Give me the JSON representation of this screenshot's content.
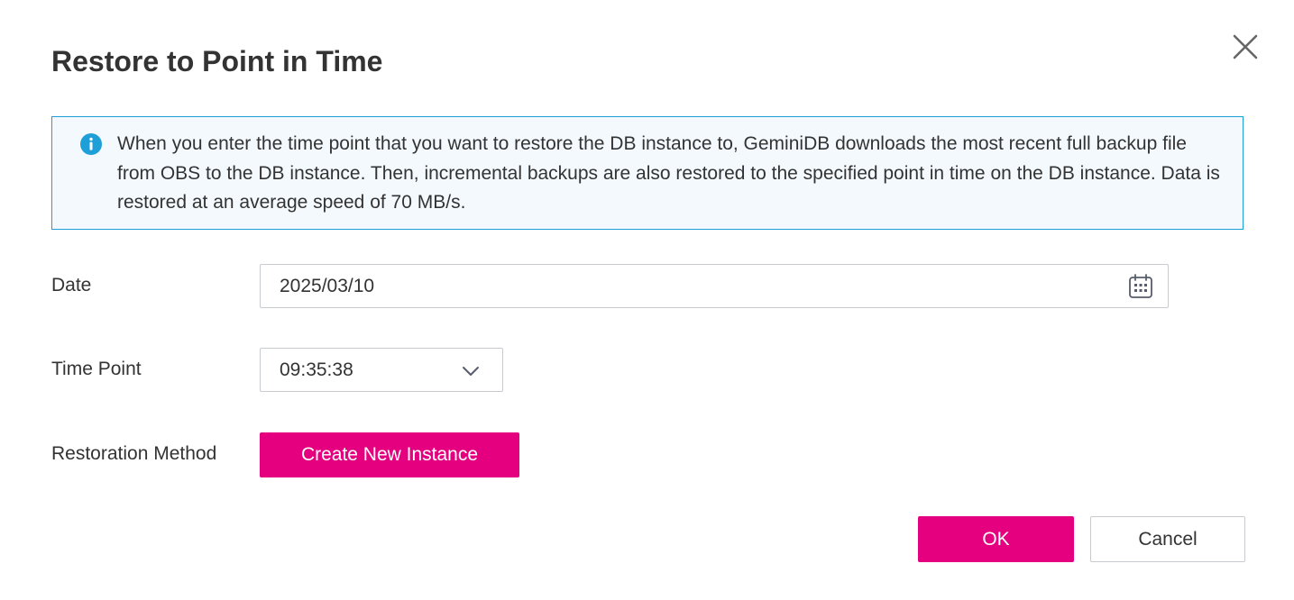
{
  "dialog": {
    "title": "Restore to Point in Time"
  },
  "info": {
    "text": "When you enter the time point that you want to restore the DB instance to, GeminiDB downloads the most recent full backup file from OBS to the DB instance. Then, incremental backups are also restored to the specified point in time on the DB instance. Data is restored at an average speed of 70 MB/s."
  },
  "form": {
    "date_label": "Date",
    "date_value": "2025/03/10",
    "time_label": "Time Point",
    "time_value": "09:35:38",
    "method_label": "Restoration Method",
    "method_button": "Create New Instance"
  },
  "footer": {
    "ok_label": "OK",
    "cancel_label": "Cancel"
  },
  "colors": {
    "primary": "#e4007f",
    "info_border": "#1f9fd8",
    "info_background": "#f3f9fd",
    "info_icon": "#1f9fd8"
  },
  "icons": {
    "close": "close-icon",
    "info": "info-icon",
    "calendar": "calendar-icon",
    "dropdown": "chevron-down-icon"
  }
}
